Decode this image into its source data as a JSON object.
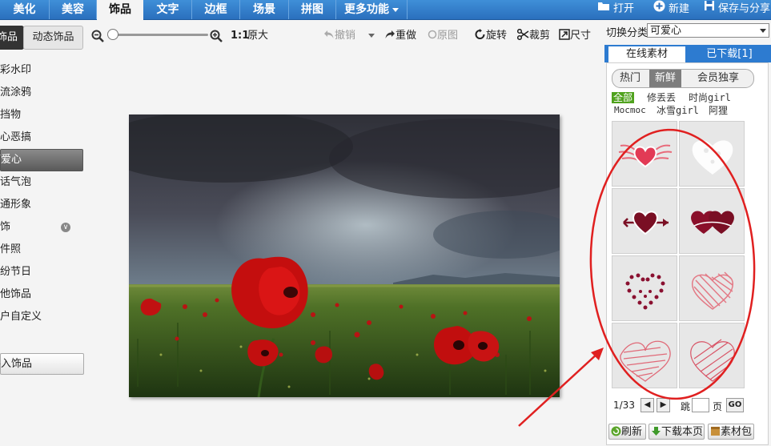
{
  "menu": {
    "tabs": [
      "美化",
      "美容",
      "饰品",
      "文字",
      "边框",
      "场景",
      "拼图",
      "更多功能"
    ],
    "active_index": 2,
    "right_actions": [
      "打开",
      "新建",
      "保存与分享"
    ]
  },
  "left_panel": {
    "subtabs": [
      "饰品",
      "动态饰品"
    ],
    "categories": [
      "炫彩水印",
      "潮流涂鸦",
      "遮挡物",
      "开心恶搞",
      "可爱心",
      "会话气泡",
      "卡通形象",
      "配饰",
      "证件照",
      "缤纷节日",
      "其他饰品",
      "用户自定义"
    ],
    "active_category": "可爱心",
    "import_button": "导入饰品"
  },
  "toolbar": {
    "zoom_ratio": "1:1",
    "original_size": "原大",
    "undo": "撤销",
    "redo": "重做",
    "original_image": "原图",
    "rotate": "旋转",
    "crop": "裁剪",
    "resize": "尺寸"
  },
  "right_panel": {
    "switch_label": "切换分类",
    "category_value": "可爱心",
    "tabs": [
      "在线素材",
      "已下载[1]"
    ],
    "pills": [
      "热门",
      "新鲜",
      "会员独享"
    ],
    "active_pill": "新鲜",
    "filters": [
      "全部",
      "修丢丢",
      "时尚girl",
      "Mocmoc",
      "冰雪girl",
      "阿狸"
    ],
    "active_filter": "全部",
    "pager": {
      "page_text": "1/33",
      "jump_text": "跳",
      "page_suffix": "页",
      "go": "GO"
    },
    "bottom_buttons": [
      "刷新",
      "下载本页",
      "素材包"
    ]
  },
  "colors": {
    "menu_blue": "#2a6fbd",
    "tab_blue": "#2d7bd0",
    "annotation_red": "#e02020",
    "filter_green": "#4fa21d"
  }
}
